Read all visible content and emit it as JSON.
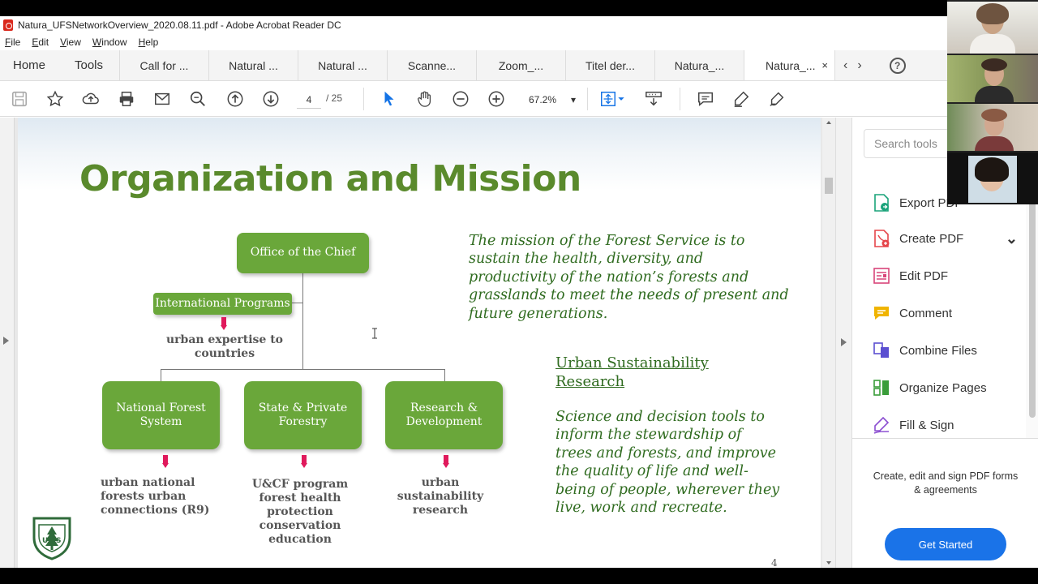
{
  "window": {
    "title": "Natura_UFSNetworkOverview_2020.08.11.pdf - Adobe Acrobat Reader DC",
    "menu": [
      "File",
      "Edit",
      "View",
      "Window",
      "Help"
    ]
  },
  "tabs": {
    "home": "Home",
    "tools": "Tools",
    "documents": [
      "Call for ...",
      "Natural ...",
      "Natural ...",
      "Scanne...",
      "Zoom_...",
      "Titel der...",
      "Natura_..."
    ],
    "active": "Natura_...",
    "close": "×",
    "prev": "‹",
    "next": "›",
    "help": "?"
  },
  "toolbar": {
    "current_page": "4",
    "page_total": "/ 25",
    "zoom": "67.2%",
    "zoom_caret": "▾"
  },
  "slide": {
    "title": "Organization and Mission",
    "office": "Office of the Chief",
    "international": "International Programs",
    "international_caption": "urban expertise to countries",
    "boxes": [
      {
        "label": "National Forest System",
        "caption": "urban national forests urban connections (R9)"
      },
      {
        "label": "State & Private Forestry",
        "caption": "U&CF program forest health protection conservation education"
      },
      {
        "label": "Research & Development",
        "caption": "urban sustainability research"
      }
    ],
    "mission": "The mission of the Forest Service is to sustain the health, diversity, and productivity of the nation’s forests and grasslands to meet the needs of present and future generations.",
    "usr_title": "Urban Sustainability Research",
    "usr_body": "Science and decision tools to inform the stewardship of trees and forests, and improve the quality of life and well-being of people, wherever they live, work and recreate.",
    "page_number": "4",
    "colors": {
      "title": "#5a8a2c",
      "box": "#6aa73a",
      "arrow": "#e0195c",
      "mission_text": "#2f6b1f"
    }
  },
  "right_panel": {
    "search_placeholder": "Search tools",
    "tools": [
      {
        "label": "Export PDF",
        "icon": "export-pdf-icon",
        "color": "#1aa37a"
      },
      {
        "label": "Create PDF",
        "icon": "create-pdf-icon",
        "color": "#e5454a"
      },
      {
        "label": "Edit PDF",
        "icon": "edit-pdf-icon",
        "color": "#d9457a"
      },
      {
        "label": "Comment",
        "icon": "comment-icon",
        "color": "#f0b400"
      },
      {
        "label": "Combine Files",
        "icon": "combine-files-icon",
        "color": "#5b4fd1"
      },
      {
        "label": "Organize Pages",
        "icon": "organize-pages-icon",
        "color": "#3a9d3a"
      },
      {
        "label": "Fill & Sign",
        "icon": "fill-sign-icon",
        "color": "#8b4ed1"
      }
    ],
    "promo_text": "Create, edit and sign PDF forms & agreements",
    "get_started": "Get Started",
    "create_chevron": "⌄"
  }
}
